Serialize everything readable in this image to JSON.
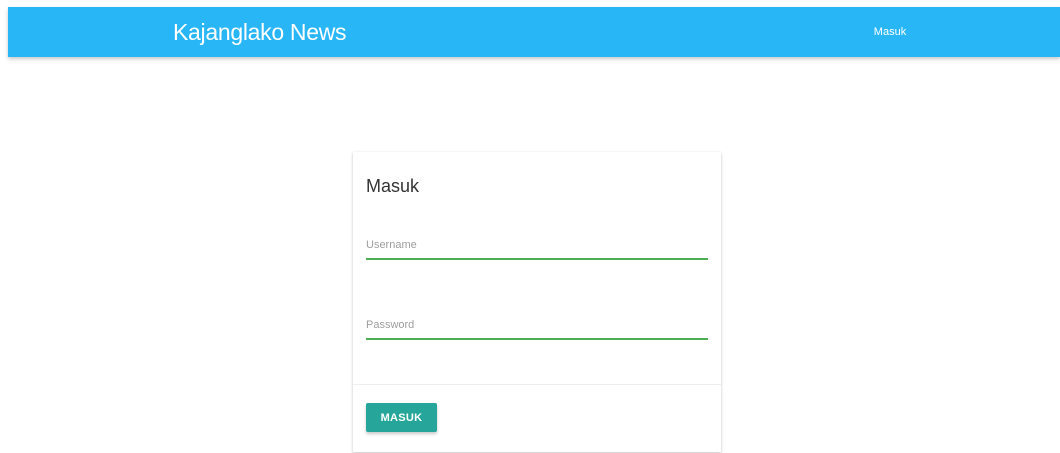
{
  "navbar": {
    "brand": "Kajanglako News",
    "login_link": "Masuk"
  },
  "login_card": {
    "title": "Masuk",
    "username": {
      "placeholder": "Username",
      "value": ""
    },
    "password": {
      "placeholder": "Password",
      "value": ""
    },
    "submit_label": "MASUK"
  },
  "colors": {
    "navbar": "#29b6f6",
    "input_underline": "#4caf50",
    "button": "#26a69a"
  }
}
